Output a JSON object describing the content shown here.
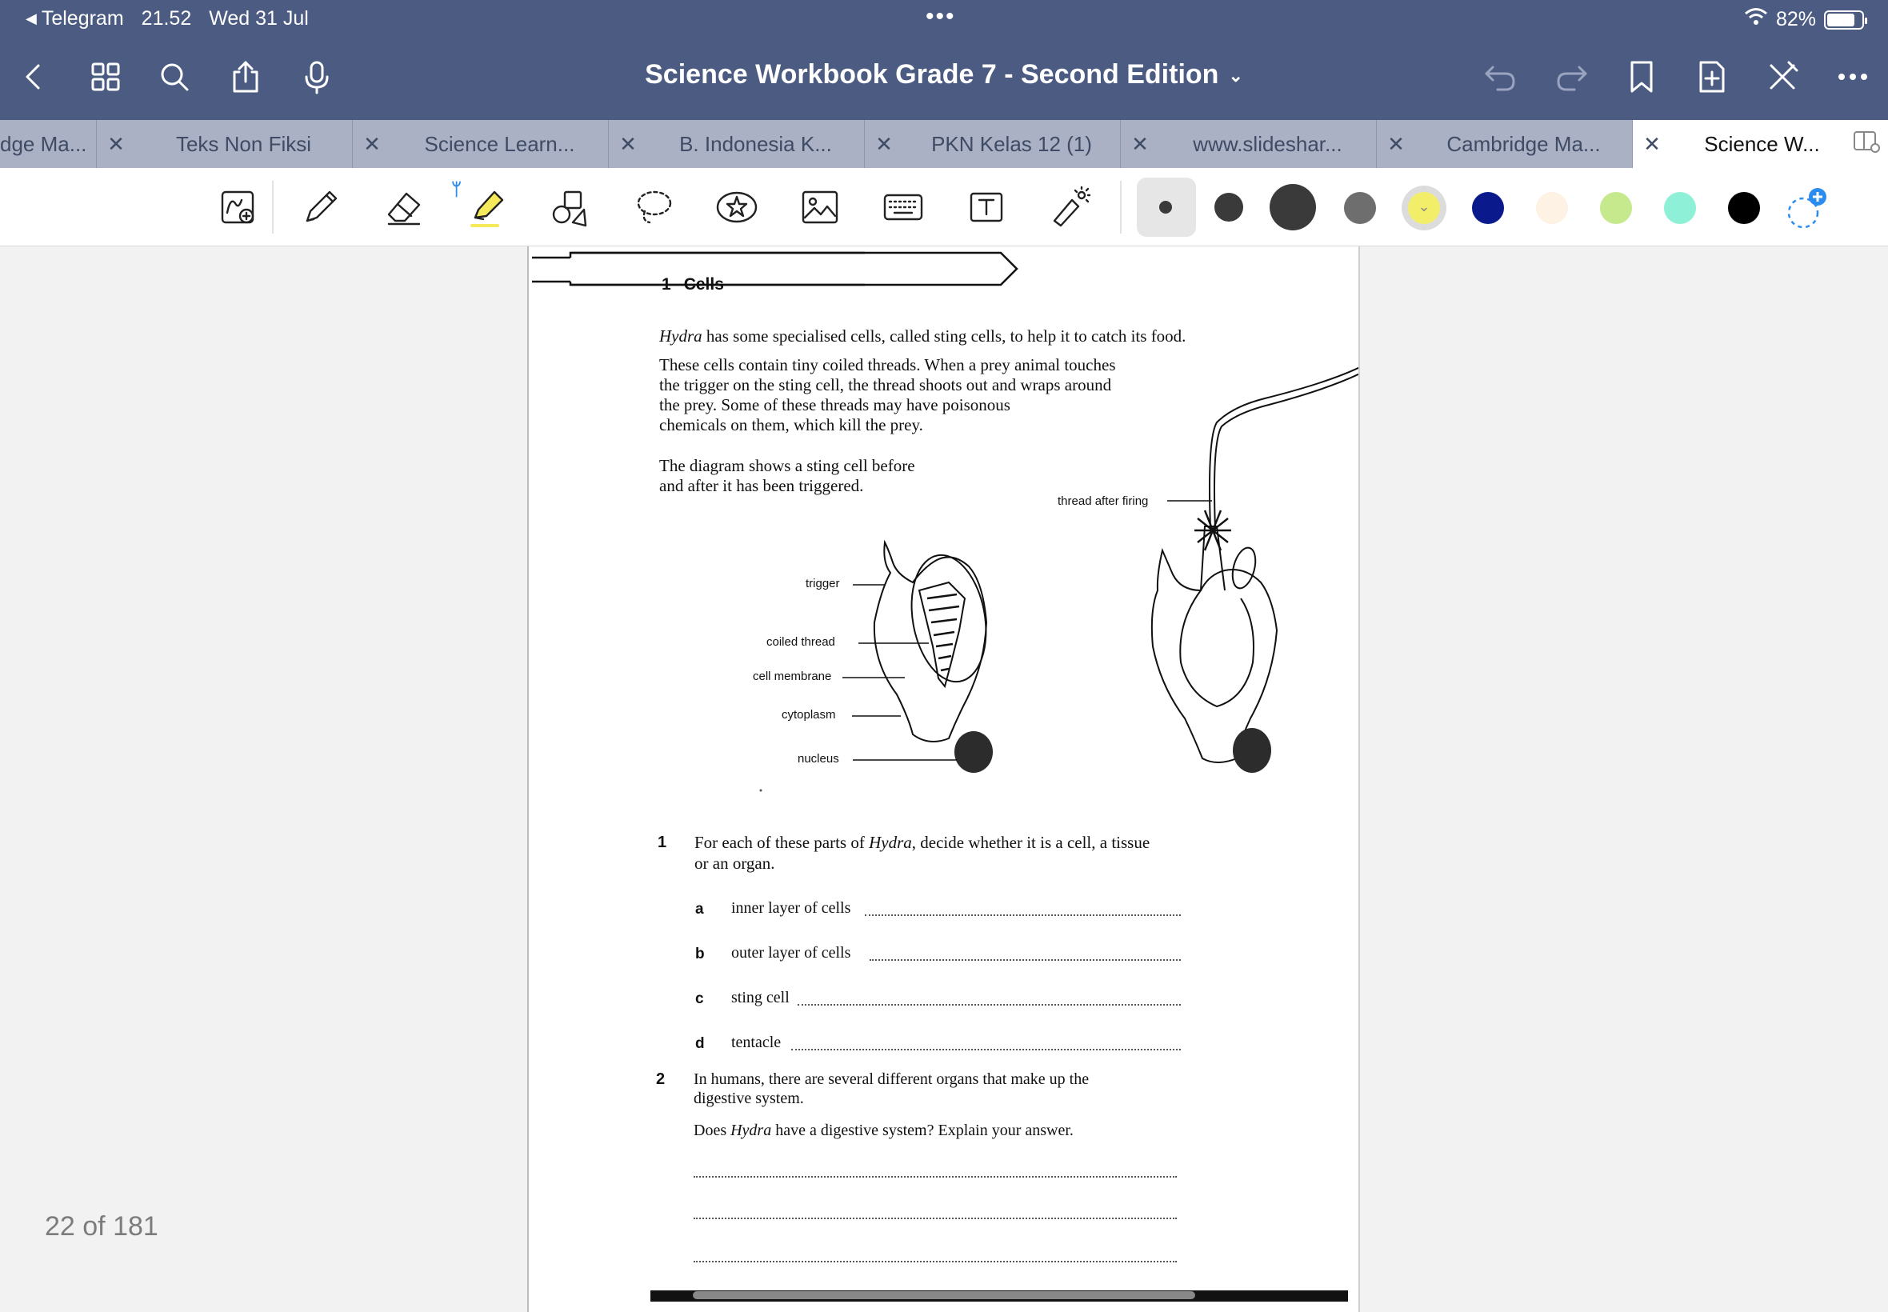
{
  "status_bar": {
    "back_app": "Telegram",
    "time": "21.52",
    "date": "Wed 31 Jul",
    "battery_percent": "82%",
    "battery_level": 0.82
  },
  "navbar": {
    "title": "Science Workbook Grade 7 - Second Edition",
    "icons": [
      "chevron-left-icon",
      "grid-icon",
      "search-icon",
      "share-icon",
      "microphone-icon",
      "undo-icon",
      "redo-icon",
      "bookmark-icon",
      "add-page-icon",
      "close-toolbar-icon",
      "more-icon"
    ]
  },
  "tabs": [
    {
      "label": "dge Ma..."
    },
    {
      "label": "Teks Non Fiksi"
    },
    {
      "label": "Science Learn..."
    },
    {
      "label": "B. Indonesia K..."
    },
    {
      "label": "PKN Kelas 12 (1)"
    },
    {
      "label": "www.slideshar..."
    },
    {
      "label": "Cambridge Ma..."
    },
    {
      "label": "Science W...",
      "active": true
    }
  ],
  "toolbar": {
    "tools": [
      "zoom-lasso-icon",
      "pen-icon",
      "eraser-icon",
      "highlighter-icon",
      "shapes-icon",
      "lasso-icon",
      "sticker-icon",
      "image-icon",
      "keyboard-icon",
      "text-icon",
      "laser-pointer-icon"
    ],
    "colors": {
      "accent": "#4b5b82",
      "bluetooth": "#2b8cf0",
      "highlighter_yellow": "#f5ea5a",
      "swatches": [
        "#3a3a3a",
        "#3a3a3a",
        "#3a3a3a",
        "#6e6e6e",
        "#f2ee6a",
        "#0a1a8c",
        "#fdf2e4",
        "#c6e98e",
        "#8ff0d8",
        "#000000"
      ]
    }
  },
  "page_counter": "22 of 181",
  "document": {
    "chapter_number": "1",
    "chapter_title": "Cells",
    "intro_line1_italic": "Hydra",
    "intro_line1_rest": " has some specialised cells, called sting cells, to help it to catch its food.",
    "intro_p2": [
      "These cells contain tiny coiled threads. When a prey animal touches",
      "the trigger on the sting cell, the thread shoots out and wraps around",
      "the prey. Some of these threads may have poisonous",
      "chemicals on them, which kill the prey."
    ],
    "intro_p3": [
      "The diagram shows a sting cell before",
      "and after it has been triggered."
    ],
    "diagram_labels": {
      "trigger": "trigger",
      "coiled_thread": "coiled thread",
      "cell_membrane": "cell membrane",
      "cytoplasm": "cytoplasm",
      "nucleus": "nucleus",
      "thread_after_firing": "thread after firing"
    },
    "q1": {
      "number": "1",
      "line1_a": "For each of these parts of ",
      "line1_italic": "Hydra",
      "line1_b": ", decide whether it is a cell, a tissue",
      "line2": "or an organ.",
      "parts": [
        {
          "letter": "a",
          "text": "inner layer of cells"
        },
        {
          "letter": "b",
          "text": "outer layer of cells"
        },
        {
          "letter": "c",
          "text": "sting cell"
        },
        {
          "letter": "d",
          "text": "tentacle"
        }
      ]
    },
    "q2": {
      "number": "2",
      "line1": "In humans, there are several different organs that make up the",
      "line2": "digestive system.",
      "line3_a": "Does ",
      "line3_italic": "Hydra",
      "line3_b": " have a digestive system? Explain your answer."
    }
  }
}
